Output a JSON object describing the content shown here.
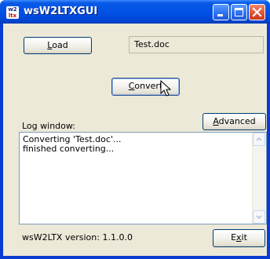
{
  "window": {
    "title": "wsW2LTXGUI",
    "icon": "wsw2ltx-app-icon",
    "icon_text_top": "w2",
    "icon_text_bottom": "ltx",
    "controls": [
      "minimize-icon",
      "maximize-icon",
      "close-icon"
    ]
  },
  "main": {
    "load_button": {
      "pre": "",
      "accel": "L",
      "post": "oad"
    },
    "file_name": "Test.doc",
    "convert_button": {
      "pre": "",
      "accel": "C",
      "post": "onvert"
    },
    "log_label": "Log window:",
    "advanced_button": {
      "pre": "",
      "accel": "A",
      "post": "dvanced"
    },
    "log_lines": [
      "Converting 'Test.doc'...",
      "finished converting..."
    ],
    "version_text": "wsW2LTX version: 1.1.0.0",
    "exit_button": {
      "pre": "E",
      "accel": "x",
      "post": "it"
    }
  },
  "colors": {
    "titlebar": "#0050e6",
    "client_bg": "#ece9d8",
    "button_border": "#003c74",
    "close_button": "#e0502e"
  }
}
